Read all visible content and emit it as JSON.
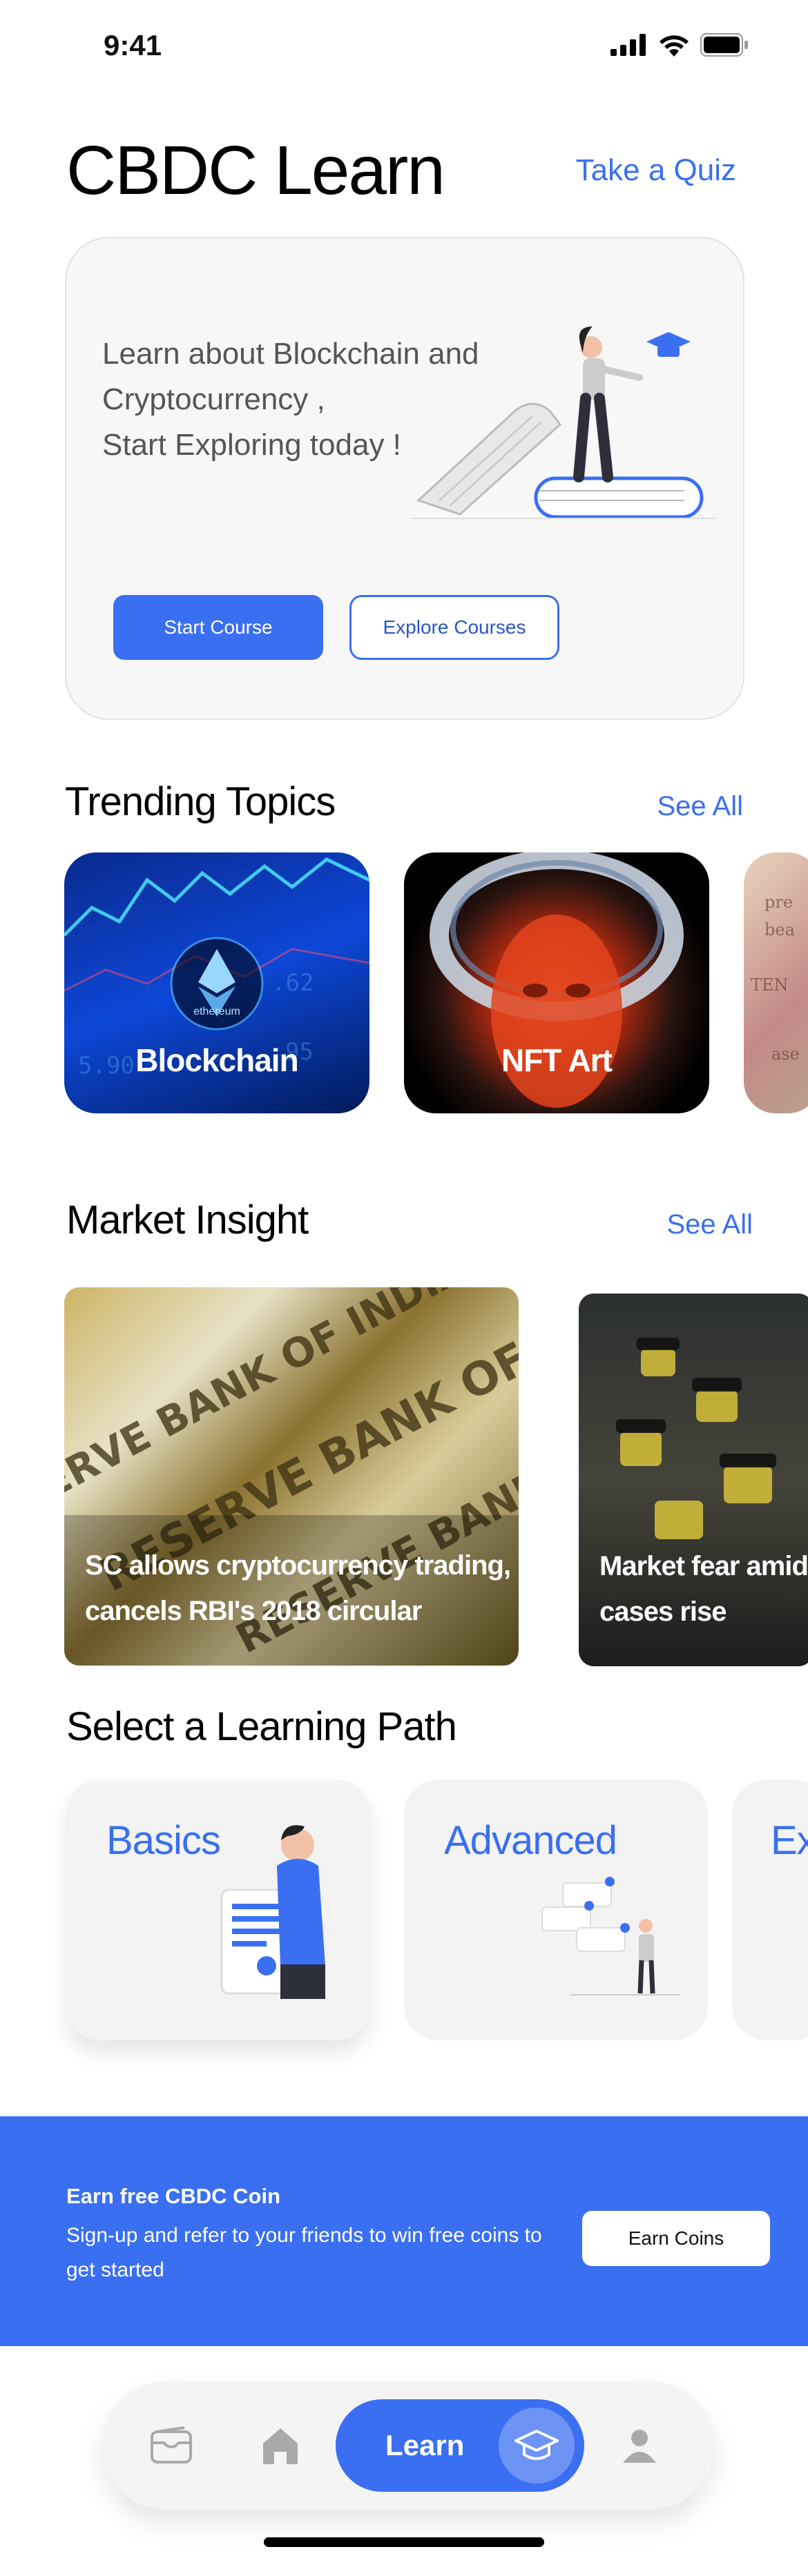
{
  "status_bar": {
    "time": "9:41"
  },
  "header": {
    "title": "CBDC Learn",
    "quiz_link": "Take a Quiz"
  },
  "hero": {
    "lines": [
      "Learn about Blockchain and",
      "Cryptocurrency ,",
      "Start Exploring today !"
    ],
    "primary_button": "Start Course",
    "secondary_button": "Explore Courses"
  },
  "trending": {
    "title": "Trending Topics",
    "see_all": "See All",
    "cards": [
      {
        "label": "Blockchain",
        "logo_text": "ethereum"
      },
      {
        "label": "NFT Art"
      },
      {
        "label": ""
      }
    ]
  },
  "market": {
    "title": "Market Insight",
    "see_all": "See All",
    "cards": [
      {
        "line1": "SC allows cryptocurrency trading,",
        "line2": "cancels RBI's 2018 circular",
        "image_text": "RESERVE BANK OF INDIA"
      },
      {
        "line1": "Market fear amid",
        "line2": "cases rise"
      }
    ]
  },
  "paths": {
    "title": "Select a Learning Path",
    "cards": [
      {
        "label": "Basics"
      },
      {
        "label": "Advanced"
      },
      {
        "label": "Ex"
      }
    ]
  },
  "promo": {
    "heading": "Earn free CBDC Coin",
    "body": "Sign-up and refer to your friends to win free coins to get started",
    "button": "Earn Coins"
  },
  "nav": {
    "items": [
      {
        "icon": "wallet-icon"
      },
      {
        "icon": "home-icon"
      },
      {
        "label": "Learn",
        "icon": "graduation-cap-icon",
        "active": true
      },
      {
        "icon": "profile-icon"
      }
    ]
  },
  "colors": {
    "accent": "#3a6ff2",
    "card_bg": "#f3f3f3",
    "text": "#111111"
  }
}
